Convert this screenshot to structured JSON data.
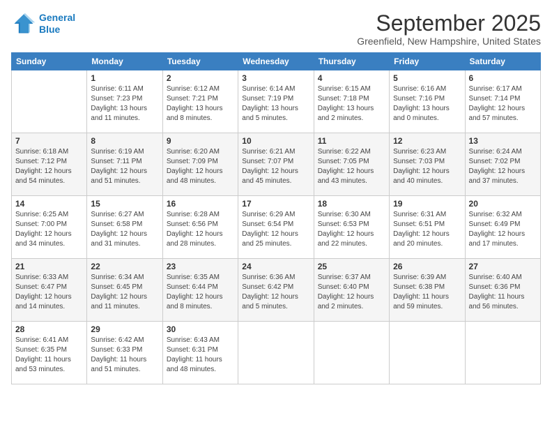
{
  "header": {
    "logo": {
      "line1": "General",
      "line2": "Blue"
    },
    "title": "September 2025",
    "location": "Greenfield, New Hampshire, United States"
  },
  "days_of_week": [
    "Sunday",
    "Monday",
    "Tuesday",
    "Wednesday",
    "Thursday",
    "Friday",
    "Saturday"
  ],
  "weeks": [
    [
      {
        "day": "",
        "info": ""
      },
      {
        "day": "1",
        "info": "Sunrise: 6:11 AM\nSunset: 7:23 PM\nDaylight: 13 hours\nand 11 minutes."
      },
      {
        "day": "2",
        "info": "Sunrise: 6:12 AM\nSunset: 7:21 PM\nDaylight: 13 hours\nand 8 minutes."
      },
      {
        "day": "3",
        "info": "Sunrise: 6:14 AM\nSunset: 7:19 PM\nDaylight: 13 hours\nand 5 minutes."
      },
      {
        "day": "4",
        "info": "Sunrise: 6:15 AM\nSunset: 7:18 PM\nDaylight: 13 hours\nand 2 minutes."
      },
      {
        "day": "5",
        "info": "Sunrise: 6:16 AM\nSunset: 7:16 PM\nDaylight: 13 hours\nand 0 minutes."
      },
      {
        "day": "6",
        "info": "Sunrise: 6:17 AM\nSunset: 7:14 PM\nDaylight: 12 hours\nand 57 minutes."
      }
    ],
    [
      {
        "day": "7",
        "info": "Sunrise: 6:18 AM\nSunset: 7:12 PM\nDaylight: 12 hours\nand 54 minutes."
      },
      {
        "day": "8",
        "info": "Sunrise: 6:19 AM\nSunset: 7:11 PM\nDaylight: 12 hours\nand 51 minutes."
      },
      {
        "day": "9",
        "info": "Sunrise: 6:20 AM\nSunset: 7:09 PM\nDaylight: 12 hours\nand 48 minutes."
      },
      {
        "day": "10",
        "info": "Sunrise: 6:21 AM\nSunset: 7:07 PM\nDaylight: 12 hours\nand 45 minutes."
      },
      {
        "day": "11",
        "info": "Sunrise: 6:22 AM\nSunset: 7:05 PM\nDaylight: 12 hours\nand 43 minutes."
      },
      {
        "day": "12",
        "info": "Sunrise: 6:23 AM\nSunset: 7:03 PM\nDaylight: 12 hours\nand 40 minutes."
      },
      {
        "day": "13",
        "info": "Sunrise: 6:24 AM\nSunset: 7:02 PM\nDaylight: 12 hours\nand 37 minutes."
      }
    ],
    [
      {
        "day": "14",
        "info": "Sunrise: 6:25 AM\nSunset: 7:00 PM\nDaylight: 12 hours\nand 34 minutes."
      },
      {
        "day": "15",
        "info": "Sunrise: 6:27 AM\nSunset: 6:58 PM\nDaylight: 12 hours\nand 31 minutes."
      },
      {
        "day": "16",
        "info": "Sunrise: 6:28 AM\nSunset: 6:56 PM\nDaylight: 12 hours\nand 28 minutes."
      },
      {
        "day": "17",
        "info": "Sunrise: 6:29 AM\nSunset: 6:54 PM\nDaylight: 12 hours\nand 25 minutes."
      },
      {
        "day": "18",
        "info": "Sunrise: 6:30 AM\nSunset: 6:53 PM\nDaylight: 12 hours\nand 22 minutes."
      },
      {
        "day": "19",
        "info": "Sunrise: 6:31 AM\nSunset: 6:51 PM\nDaylight: 12 hours\nand 20 minutes."
      },
      {
        "day": "20",
        "info": "Sunrise: 6:32 AM\nSunset: 6:49 PM\nDaylight: 12 hours\nand 17 minutes."
      }
    ],
    [
      {
        "day": "21",
        "info": "Sunrise: 6:33 AM\nSunset: 6:47 PM\nDaylight: 12 hours\nand 14 minutes."
      },
      {
        "day": "22",
        "info": "Sunrise: 6:34 AM\nSunset: 6:45 PM\nDaylight: 12 hours\nand 11 minutes."
      },
      {
        "day": "23",
        "info": "Sunrise: 6:35 AM\nSunset: 6:44 PM\nDaylight: 12 hours\nand 8 minutes."
      },
      {
        "day": "24",
        "info": "Sunrise: 6:36 AM\nSunset: 6:42 PM\nDaylight: 12 hours\nand 5 minutes."
      },
      {
        "day": "25",
        "info": "Sunrise: 6:37 AM\nSunset: 6:40 PM\nDaylight: 12 hours\nand 2 minutes."
      },
      {
        "day": "26",
        "info": "Sunrise: 6:39 AM\nSunset: 6:38 PM\nDaylight: 11 hours\nand 59 minutes."
      },
      {
        "day": "27",
        "info": "Sunrise: 6:40 AM\nSunset: 6:36 PM\nDaylight: 11 hours\nand 56 minutes."
      }
    ],
    [
      {
        "day": "28",
        "info": "Sunrise: 6:41 AM\nSunset: 6:35 PM\nDaylight: 11 hours\nand 53 minutes."
      },
      {
        "day": "29",
        "info": "Sunrise: 6:42 AM\nSunset: 6:33 PM\nDaylight: 11 hours\nand 51 minutes."
      },
      {
        "day": "30",
        "info": "Sunrise: 6:43 AM\nSunset: 6:31 PM\nDaylight: 11 hours\nand 48 minutes."
      },
      {
        "day": "",
        "info": ""
      },
      {
        "day": "",
        "info": ""
      },
      {
        "day": "",
        "info": ""
      },
      {
        "day": "",
        "info": ""
      }
    ]
  ]
}
